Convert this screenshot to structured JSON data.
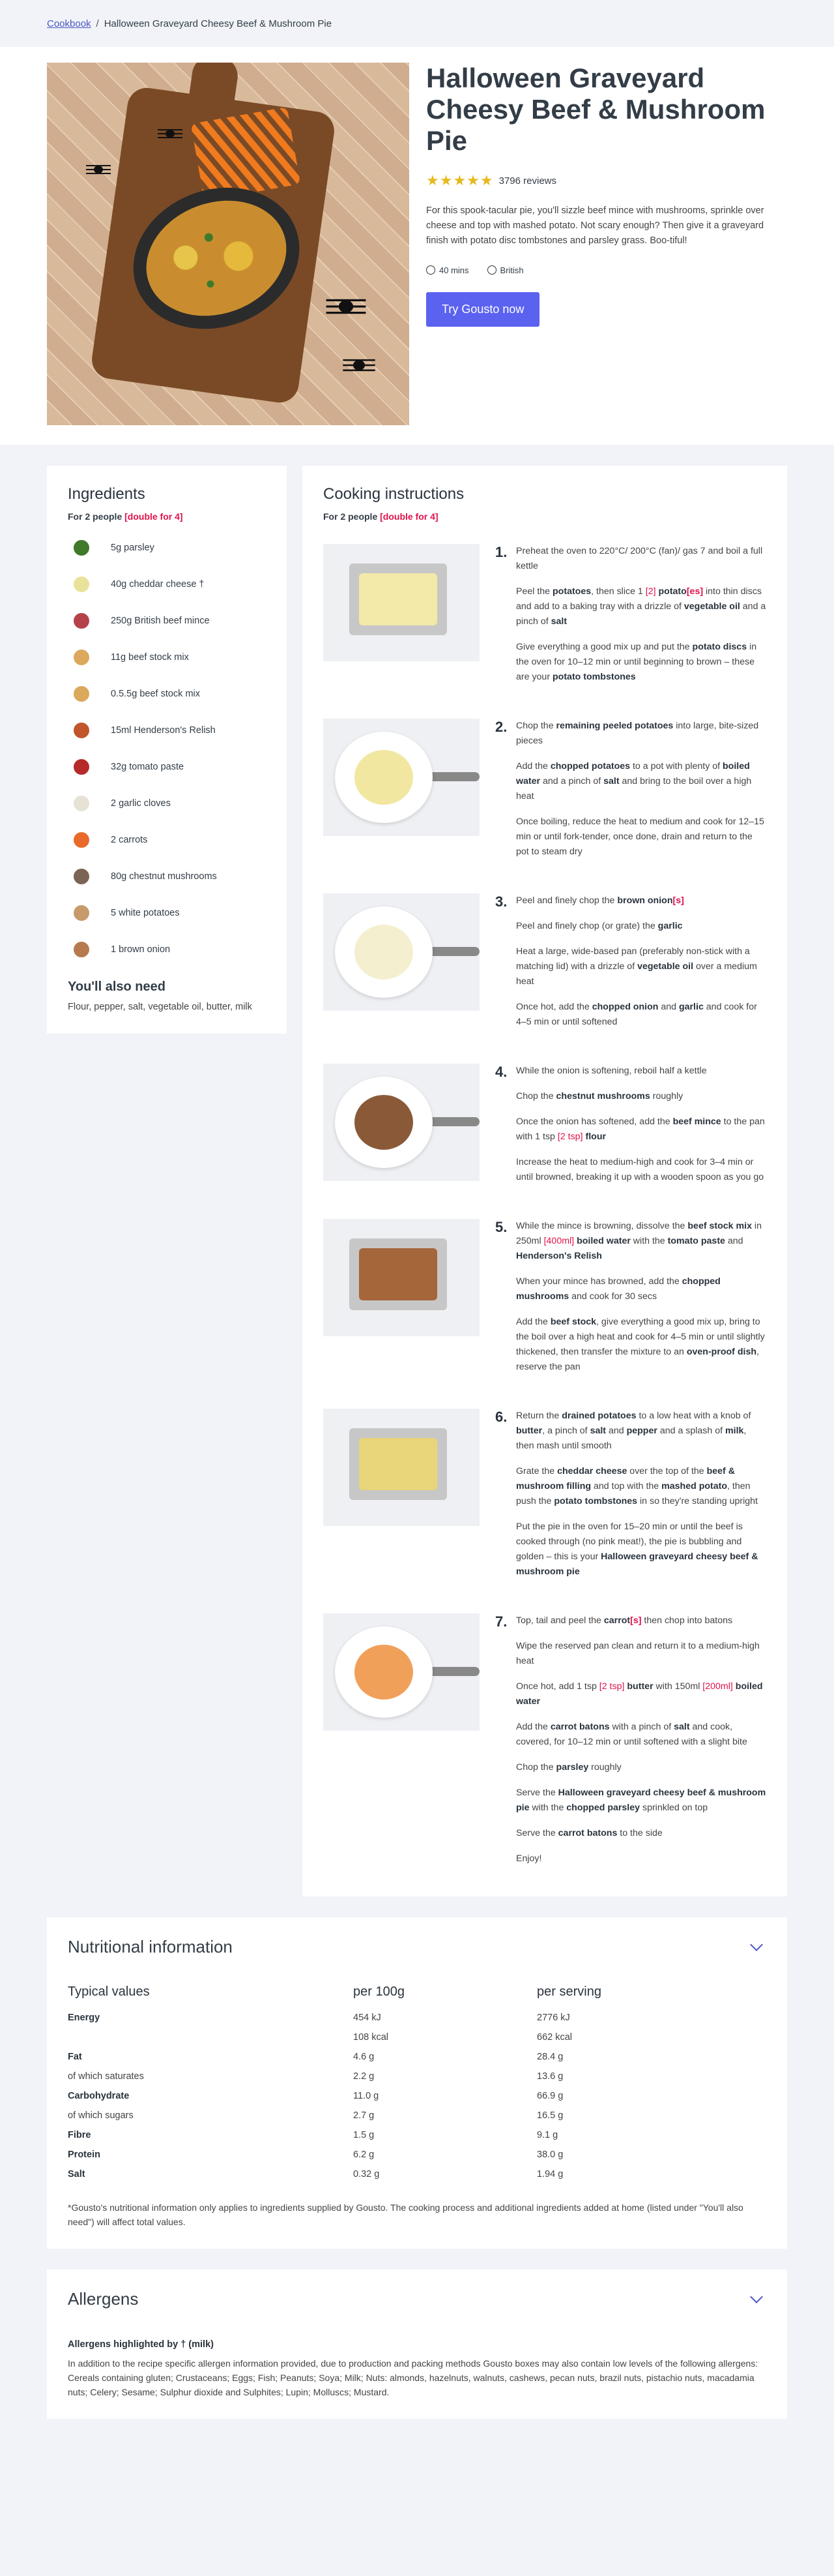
{
  "breadcrumb": {
    "link": "Cookbook",
    "separator": "/",
    "current": "Halloween Graveyard Cheesy Beef & Mushroom Pie"
  },
  "hero": {
    "title": "Halloween Graveyard Cheesy Beef & Mushroom Pie",
    "stars": "★★★★★",
    "rating_value": 4.5,
    "reviews": "3796 reviews",
    "description": "For this spook-tacular pie, you'll sizzle beef mince with mushrooms, sprinkle over cheese and top with mashed potato. Not scary enough? Then give it a graveyard finish with potato disc tombstones and parsley grass. Boo-tiful!",
    "time": "40 mins",
    "cuisine": "British",
    "cta": "Try Gousto now"
  },
  "ingredients": {
    "title": "Ingredients",
    "serving_prefix": "For 2 people",
    "serving_double": "[double for 4]",
    "items": [
      {
        "text": "5g parsley",
        "icon": "parsley-icon",
        "color": "#3f7a2a"
      },
      {
        "text": "40g cheddar cheese †",
        "icon": "cheese-icon",
        "color": "#e9e29a"
      },
      {
        "text": "250g British beef mince",
        "icon": "beef-mince-icon",
        "color": "#b5424a"
      },
      {
        "text": "11g beef stock mix",
        "icon": "stock-mix-icon",
        "color": "#dba85c"
      },
      {
        "text": "0.5.5g beef stock mix",
        "icon": "stock-mix-icon",
        "color": "#dba85c"
      },
      {
        "text": "15ml Henderson's Relish",
        "icon": "relish-bottle-icon",
        "color": "#c0562a"
      },
      {
        "text": "32g tomato paste",
        "icon": "tomato-paste-icon",
        "color": "#b52a2a"
      },
      {
        "text": "2 garlic cloves",
        "icon": "garlic-icon",
        "color": "#e6e2d6"
      },
      {
        "text": "2 carrots",
        "icon": "carrot-icon",
        "color": "#e8692a"
      },
      {
        "text": "80g chestnut mushrooms",
        "icon": "mushroom-icon",
        "color": "#7b6453"
      },
      {
        "text": "5 white potatoes",
        "icon": "potato-icon",
        "color": "#c79a6b"
      },
      {
        "text": "1 brown onion",
        "icon": "onion-icon",
        "color": "#b77a4e"
      }
    ],
    "also_title": "You'll also need",
    "also_text": "Flour, pepper, salt, vegetable oil, butter, milk"
  },
  "cooking": {
    "title": "Cooking instructions",
    "serving_prefix": "For 2 people",
    "serving_double": "[double for 4]",
    "steps": [
      {
        "num": "1.",
        "img": "tray",
        "fill": "#f3e9a8",
        "paras": [
          "Preheat the oven to 220°C/ 200°C (fan)/ gas 7 and boil a full kettle",
          "Peel the <b>potatoes</b>, then slice 1 <span class='r'>[2]</span> <b>potato<span class='r'>[es]</span></b> into thin discs and add to a baking tray with a drizzle of <b>vegetable oil</b> and a pinch of <b>salt</b>",
          "Give everything a good mix up and put the <b>potato discs</b> in the oven for 10–12 min or until beginning to brown – these are your <b>potato tombstones</b>"
        ]
      },
      {
        "num": "2.",
        "img": "pan",
        "fill": "#f1e7a0",
        "paras": [
          "Chop the <b>remaining peeled potatoes</b> into large, bite-sized pieces",
          "Add the <b>chopped potatoes</b> to a pot with plenty of <b>boiled water</b> and a pinch of <b>salt</b> and bring to the boil over a high heat",
          "Once boiling, reduce the heat to medium and cook for 12–15 min or until fork-tender, once done, drain and return to the pot to steam dry"
        ]
      },
      {
        "num": "3.",
        "img": "pan",
        "fill": "#f4efcf",
        "paras": [
          "Peel and finely chop the <b>brown onion<span class='r'>[s]</span></b>",
          "Peel and finely chop (or grate) the <b>garlic</b>",
          "Heat a large, wide-based pan (preferably non-stick with a matching lid) with a drizzle of <b>vegetable oil</b> over a medium heat",
          "Once hot, add the <b>chopped onion</b> and <b>garlic</b> and cook for 4–5 min or until softened"
        ]
      },
      {
        "num": "4.",
        "img": "pan",
        "fill": "#8a5a38",
        "paras": [
          "While the onion is softening, reboil half a kettle",
          "Chop the <b>chestnut mushrooms</b> roughly",
          "Once the onion has softened, add the <b>beef mince</b> to the pan with 1 tsp <span class='r'>[2 tsp]</span> <b>flour</b>",
          "Increase the heat to medium-high and cook for 3–4 min or until browned, breaking it up with a wooden spoon as you go"
        ]
      },
      {
        "num": "5.",
        "img": "tray",
        "fill": "#a5663a",
        "paras": [
          "While the mince is browning, dissolve the <b>beef stock mix</b> in 250ml <span class='r'>[400ml]</span> <b>boiled water</b> with the <b>tomato paste</b> and <b>Henderson's Relish</b>",
          "When your mince has browned, add the <b>chopped mushrooms</b> and cook for 30 secs",
          "Add the <b>beef stock</b>, give everything a good mix up, bring to the boil over a high heat and cook for 4–5 min or until slightly thickened, then transfer the mixture to an <b>oven-proof dish</b>, reserve the pan"
        ]
      },
      {
        "num": "6.",
        "img": "tray",
        "fill": "#e9d57a",
        "paras": [
          "Return the <b>drained potatoes</b> to a low heat with a knob of <b>butter</b>, a pinch of <b>salt</b> and <b>pepper</b> and a splash of <b>milk</b>, then mash until smooth",
          "Grate the <b>cheddar cheese</b> over the top of the <b>beef &amp; mushroom filling</b> and top with the <b>mashed potato</b>, then push the <b>potato tombstones</b> in so they're standing upright",
          "Put the pie in the oven for 15–20 min or until the beef is cooked through (no pink meat!), the pie is bubbling and golden – this is your <b>Halloween graveyard cheesy beef &amp; mushroom pie</b>"
        ]
      },
      {
        "num": "7.",
        "img": "pan",
        "fill": "#f1a05a",
        "paras": [
          "Top, tail and peel the <b>carrot<span class='r'>[s]</span></b> then chop into batons",
          "Wipe the reserved pan clean and return it to a medium-high heat",
          "Once hot, add 1 tsp <span class='r'>[2 tsp]</span> <b>butter</b> with 150ml <span class='r'>[200ml]</span> <b>boiled water</b>",
          "Add the <b>carrot batons</b> with a pinch of <b>salt</b> and cook, covered, for 10–12 min or until softened with a slight bite",
          "Chop the <b>parsley</b> roughly",
          "Serve the <b>Halloween graveyard cheesy beef &amp; mushroom pie</b> with the <b>chopped parsley</b> sprinkled on top",
          "Serve the <b>carrot batons</b> to the side",
          "Enjoy!"
        ]
      }
    ]
  },
  "nutrition": {
    "title": "Nutritional information",
    "headers": [
      "Typical values",
      "per 100g",
      "per serving"
    ],
    "rows": [
      {
        "label": "Energy",
        "bold": true,
        "per100": "454 kJ",
        "serving": "2776 kJ"
      },
      {
        "label": "",
        "bold": false,
        "per100": "108 kcal",
        "serving": "662 kcal"
      },
      {
        "label": "Fat",
        "bold": true,
        "per100": "4.6 g",
        "serving": "28.4 g"
      },
      {
        "label": "of which saturates",
        "bold": false,
        "per100": "2.2 g",
        "serving": "13.6 g"
      },
      {
        "label": "Carbohydrate",
        "bold": true,
        "per100": "11.0 g",
        "serving": "66.9 g"
      },
      {
        "label": "of which sugars",
        "bold": false,
        "per100": "2.7 g",
        "serving": "16.5 g"
      },
      {
        "label": "Fibre",
        "bold": true,
        "per100": "1.5 g",
        "serving": "9.1 g"
      },
      {
        "label": "Protein",
        "bold": true,
        "per100": "6.2 g",
        "serving": "38.0 g"
      },
      {
        "label": "Salt",
        "bold": true,
        "per100": "0.32 g",
        "serving": "1.94 g"
      }
    ],
    "note": "*Gousto's nutritional information only applies to ingredients supplied by Gousto. The cooking process and additional ingredients added at home (listed under \"You'll also need\") will affect total values."
  },
  "allergens": {
    "title": "Allergens",
    "highlight": "Allergens highlighted by † (milk)",
    "text": "In addition to the recipe specific allergen information provided, due to production and packing methods Gousto boxes may also contain low levels of the following allergens: Cereals containing gluten; Crustaceans; Eggs; Fish; Peanuts; Soya; Milk; Nuts: almonds, hazelnuts, walnuts, cashews, pecan nuts, brazil nuts, pistachio nuts, macadamia nuts; Celery; Sesame; Sulphur dioxide and Sulphites; Lupin; Molluscs; Mustard."
  }
}
